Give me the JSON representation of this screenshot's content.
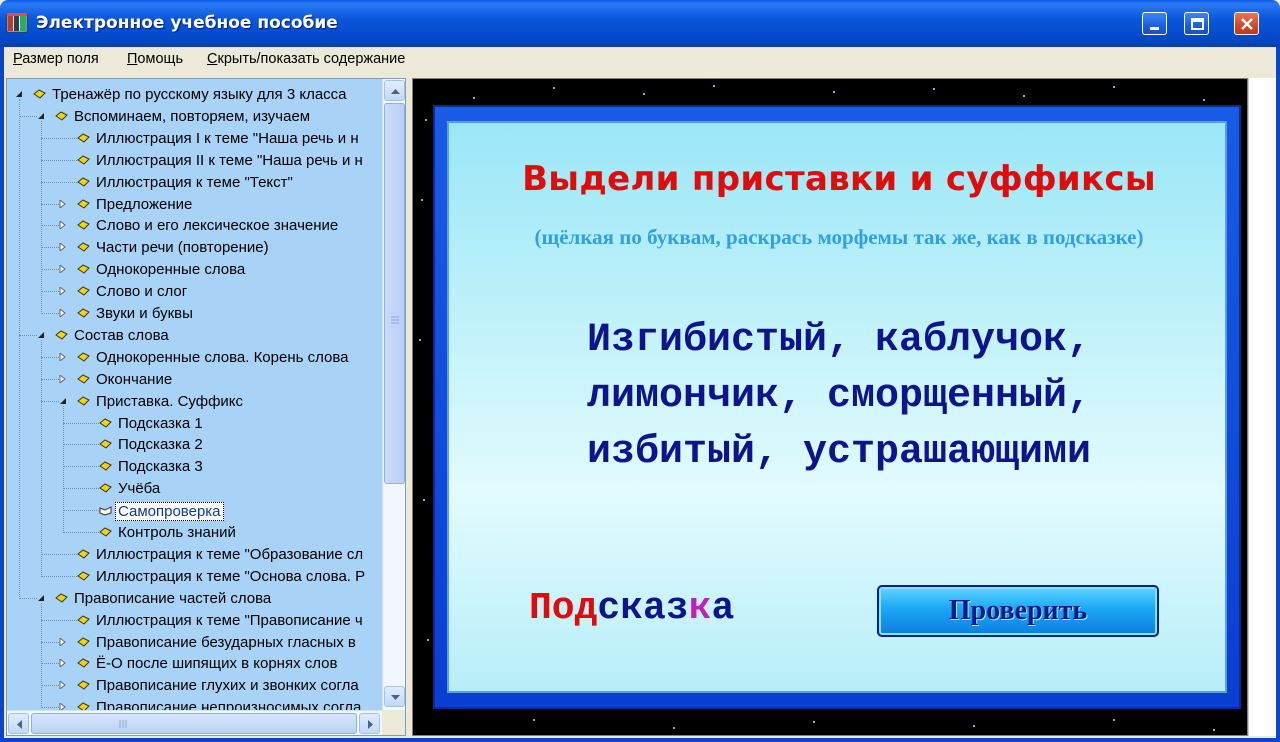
{
  "window": {
    "title": "Электронное учебное пособие",
    "icon": "book-app-icon"
  },
  "menu": {
    "items": [
      {
        "label": "Размер поля",
        "accel": "Р",
        "rest": "азмер поля"
      },
      {
        "label": "Помощь",
        "accel": "П",
        "rest": "омощь"
      },
      {
        "label": "Скрыть/показать содержание",
        "accel": "С",
        "rest": "крыть/показать содержание"
      }
    ]
  },
  "tree": {
    "items": [
      {
        "label": "Тренажёр по русскому языку для 3 класса",
        "level": 0,
        "expander": "open"
      },
      {
        "label": "Вспоминаем, повторяем, изучаем",
        "level": 1,
        "expander": "open"
      },
      {
        "label": "Иллюстрация I к теме \"Наша речь и н",
        "level": 2,
        "expander": "none"
      },
      {
        "label": "Иллюстрация II к теме \"Наша речь и н",
        "level": 2,
        "expander": "none"
      },
      {
        "label": "Иллюстрация к теме \"Текст\"",
        "level": 2,
        "expander": "none"
      },
      {
        "label": "Предложение",
        "level": 2,
        "expander": "closed"
      },
      {
        "label": "Слово и его лексическое значение",
        "level": 2,
        "expander": "closed"
      },
      {
        "label": "Части речи (повторение)",
        "level": 2,
        "expander": "closed"
      },
      {
        "label": "Однокоренные слова",
        "level": 2,
        "expander": "closed"
      },
      {
        "label": "Слово и слог",
        "level": 2,
        "expander": "closed"
      },
      {
        "label": "Звуки и буквы",
        "level": 2,
        "expander": "closed"
      },
      {
        "label": "Состав слова",
        "level": 1,
        "expander": "open"
      },
      {
        "label": "Однокоренные слова. Корень слова",
        "level": 2,
        "expander": "closed"
      },
      {
        "label": "Окончание",
        "level": 2,
        "expander": "closed"
      },
      {
        "label": "Приставка. Суффикс",
        "level": 2,
        "expander": "open"
      },
      {
        "label": "Подсказка 1",
        "level": 3,
        "expander": "none"
      },
      {
        "label": "Подсказка 2",
        "level": 3,
        "expander": "none"
      },
      {
        "label": "Подсказка 3",
        "level": 3,
        "expander": "none"
      },
      {
        "label": "Учёба",
        "level": 3,
        "expander": "none"
      },
      {
        "label": "Самопроверка",
        "level": 3,
        "expander": "none",
        "selected": true
      },
      {
        "label": "Контроль знаний",
        "level": 3,
        "expander": "none"
      },
      {
        "label": "Иллюстрация к теме \"Образование сл",
        "level": 2,
        "expander": "none"
      },
      {
        "label": "Иллюстрация к теме \"Основа слова. Р",
        "level": 2,
        "expander": "none"
      },
      {
        "label": "Правописание частей слова",
        "level": 1,
        "expander": "open"
      },
      {
        "label": "Иллюстрация к теме \"Правописание ч",
        "level": 2,
        "expander": "none"
      },
      {
        "label": "Правописание безударных гласных в",
        "level": 2,
        "expander": "closed"
      },
      {
        "label": "Ё-О после шипящих в корнях слов",
        "level": 2,
        "expander": "closed"
      },
      {
        "label": "Правописание глухих и звонких согла",
        "level": 2,
        "expander": "closed"
      },
      {
        "label": "Правописание непроизносимых согла",
        "level": 2,
        "expander": "closed"
      }
    ]
  },
  "lesson": {
    "heading": "Выдели приставки и суффиксы",
    "subheading": "(щёлкая по буквам, раскрась морфемы так же, как в подсказке)",
    "lines": [
      "Изгибистый, каблучок,",
      "лимончик, сморщенный,",
      "избитый, устрашающими"
    ],
    "hint": {
      "label": "Подсказка",
      "parts": [
        {
          "text": "Под",
          "color": "#e00b0b"
        },
        {
          "text": "сказ",
          "color": "#0d148c"
        },
        {
          "text": "к",
          "color": "#c020c0"
        },
        {
          "text": "а",
          "color": "#0d148c"
        }
      ]
    },
    "check_button": "Проверить"
  },
  "colors": {
    "titlebar": "#0b56db",
    "tree_bg": "#a9d2f7",
    "heading": "#e00b0b",
    "subheading": "#2ea0e8",
    "words": "#0d148c"
  }
}
